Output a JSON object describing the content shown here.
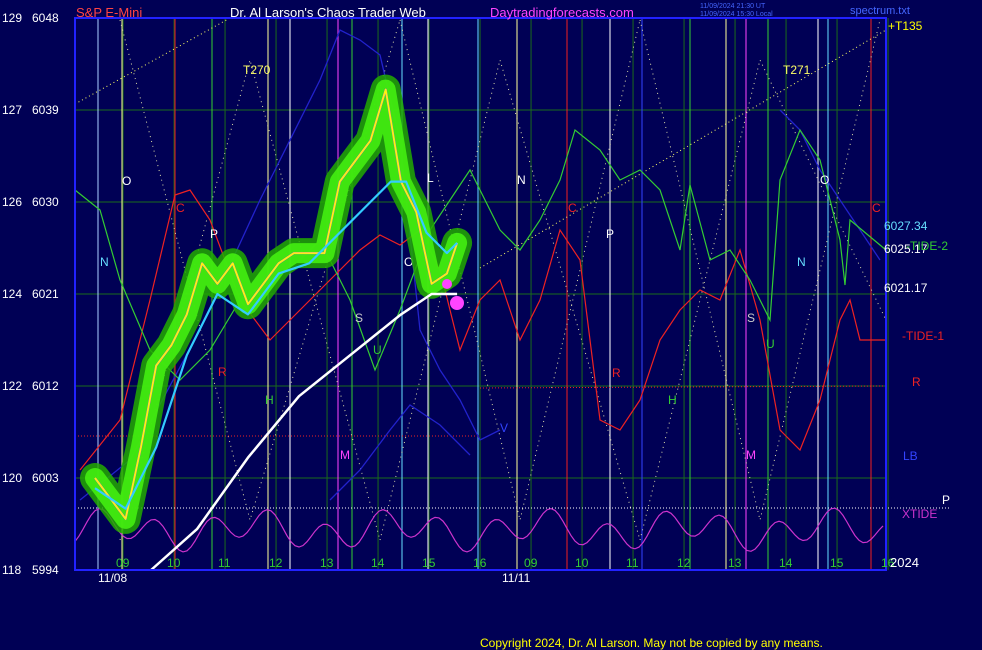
{
  "header": {
    "symbol": "S&P E-Mini",
    "title": "Dr. Al Larson's Chaos Trader Web",
    "site": "Daytradingforecasts.com",
    "stamp_line1": "11/09/2024 21:30 UT",
    "stamp_line2": "11/09/2024 15:30 Local",
    "brand": "spectrum.txt"
  },
  "footer": {
    "copyright": "Copyright 2024, Dr. Al Larson. May not be copied by any means.",
    "year": "2024"
  },
  "colors": {
    "background": "#000055",
    "frame": "#2222ff",
    "price": "#ffff00",
    "moving_average": "#33ccff",
    "long_average": "#ffffff",
    "tide1": "#ee2222",
    "tide2": "#33cc33",
    "xtide": "#cc33cc",
    "glow": "#33dd00",
    "rising_line": "#ffff66"
  },
  "chart_data": {
    "type": "line",
    "title": "S&P E-Mini",
    "ylim": [
      5994,
      6048
    ],
    "y_ticks": [
      {
        "left": "129",
        "right": "6048",
        "value": 6048
      },
      {
        "left": "127",
        "right": "6039",
        "value": 6039
      },
      {
        "left": "126",
        "right": "6030",
        "value": 6030
      },
      {
        "left": "124",
        "right": "6021",
        "value": 6021
      },
      {
        "left": "122",
        "right": "6012",
        "value": 6012
      },
      {
        "left": "120",
        "right": "6003",
        "value": 6003
      },
      {
        "left": "118",
        "right": "5994",
        "value": 5994
      }
    ],
    "x_hours": [
      "09",
      "10",
      "11",
      "12",
      "13",
      "14",
      "15",
      "16",
      "09",
      "10",
      "11",
      "12",
      "13",
      "14",
      "15",
      "16"
    ],
    "x_dates": [
      "11/08",
      "11/11"
    ],
    "x_range": [
      0,
      16
    ],
    "series": [
      {
        "name": "S&P E-Mini",
        "x": [
          0,
          0.3,
          0.6,
          0.9,
          1.2,
          1.5,
          1.8,
          2.1,
          2.4,
          2.7,
          3.0,
          3.3,
          3.6,
          3.9,
          4.2,
          4.5,
          4.8,
          5.1,
          5.4,
          5.7,
          6.0,
          6.3,
          6.6,
          6.9,
          7.1
        ],
        "values": [
          6003,
          6001,
          5999,
          6006,
          6014,
          6016,
          6019,
          6024,
          6022,
          6024,
          6020,
          6022,
          6024,
          6025,
          6025,
          6025,
          6032,
          6034,
          6036,
          6041,
          6032,
          6029,
          6022,
          6023,
          6026
        ]
      },
      {
        "name": "moving average",
        "x": [
          0,
          0.6,
          1.2,
          1.8,
          2.4,
          3.0,
          3.6,
          4.2,
          4.8,
          5.4,
          5.8,
          6.1,
          6.5,
          6.9,
          7.1
        ],
        "values": [
          6002,
          6000,
          6006,
          6015,
          6021,
          6019,
          6023,
          6024,
          6027,
          6030,
          6032,
          6032,
          6027,
          6025,
          6026
        ]
      },
      {
        "name": "long average",
        "x": [
          1.1,
          2.0,
          3.0,
          4.0,
          5.0,
          6.0,
          6.6,
          7.1
        ],
        "values": [
          5994,
          5998,
          6005,
          6011,
          6015,
          6019,
          6021,
          6021
        ]
      }
    ],
    "forecast_labels": [
      "6027.34",
      "6025.17",
      "6021.17"
    ],
    "tide_labels": [
      "-TIDE-2",
      "-TIDE-1",
      "R",
      "LB",
      "XTIDE",
      "P"
    ],
    "cycle_markers": [
      "T270",
      "T271",
      "+T135"
    ],
    "cycle_letters": [
      "O",
      "N",
      "C",
      "P",
      "R",
      "H",
      "M",
      "S",
      "U",
      "V",
      "L",
      "O",
      "N",
      "C",
      "P",
      "R",
      "H",
      "M",
      "S",
      "U",
      "N",
      "O",
      "C"
    ],
    "grid": true,
    "legend": "none"
  }
}
